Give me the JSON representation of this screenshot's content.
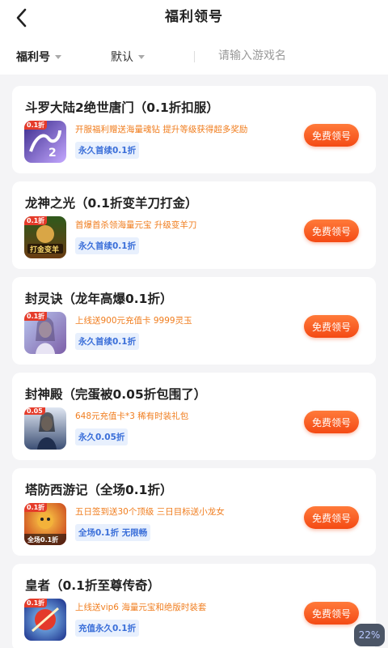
{
  "header": {
    "title": "福利领号",
    "back_icon": "chevron-left-icon"
  },
  "filters": {
    "type_label": "福利号",
    "sort_label": "默认",
    "search_placeholder": "请输入游戏名"
  },
  "colors": {
    "accent": "#f44a14",
    "desc": "#f07d1e",
    "tag_text": "#3b6fd9",
    "tag_bg": "#e8f0fd"
  },
  "games": [
    {
      "name": "斗罗大陆2绝世唐门（0.1折扣服）",
      "desc": "开服福利赠送海量魂钻  提升等级获得超多奖励",
      "tag": "永久首续0.1折",
      "button": "免费领号",
      "icon_badge": "0.1折"
    },
    {
      "name": "龙神之光（0.1折变羊刀打金）",
      "desc": "首爆首杀领海量元宝  升级变羊刀",
      "tag": "永久首续0.1折",
      "button": "免费领号",
      "icon_badge": "0.1折"
    },
    {
      "name": "封灵诀（龙年高爆0.1折）",
      "desc": "上线送900元充值卡  9999灵玉",
      "tag": "永久首续0.1折",
      "button": "免费领号",
      "icon_badge": "0.1折"
    },
    {
      "name": "封神殿（完蛋被0.05折包围了）",
      "desc": "648元充值卡*3  稀有时装礼包",
      "tag": "永久0.05折",
      "button": "免费领号",
      "icon_badge": "0.05"
    },
    {
      "name": "塔防西游记（全场0.1折）",
      "desc": "五日签到送30个顶级  三日目标送小龙女",
      "tag": "全场0.1折 无限畅",
      "button": "免费领号",
      "icon_badge": "0.1折"
    },
    {
      "name": "皇者（0.1折至尊传奇）",
      "desc": "上线送vip6  海量元宝和绝版时装套",
      "tag": "充值永久0.1折",
      "button": "免费领号",
      "icon_badge": "0.1折"
    }
  ],
  "progress_badge": "22%"
}
